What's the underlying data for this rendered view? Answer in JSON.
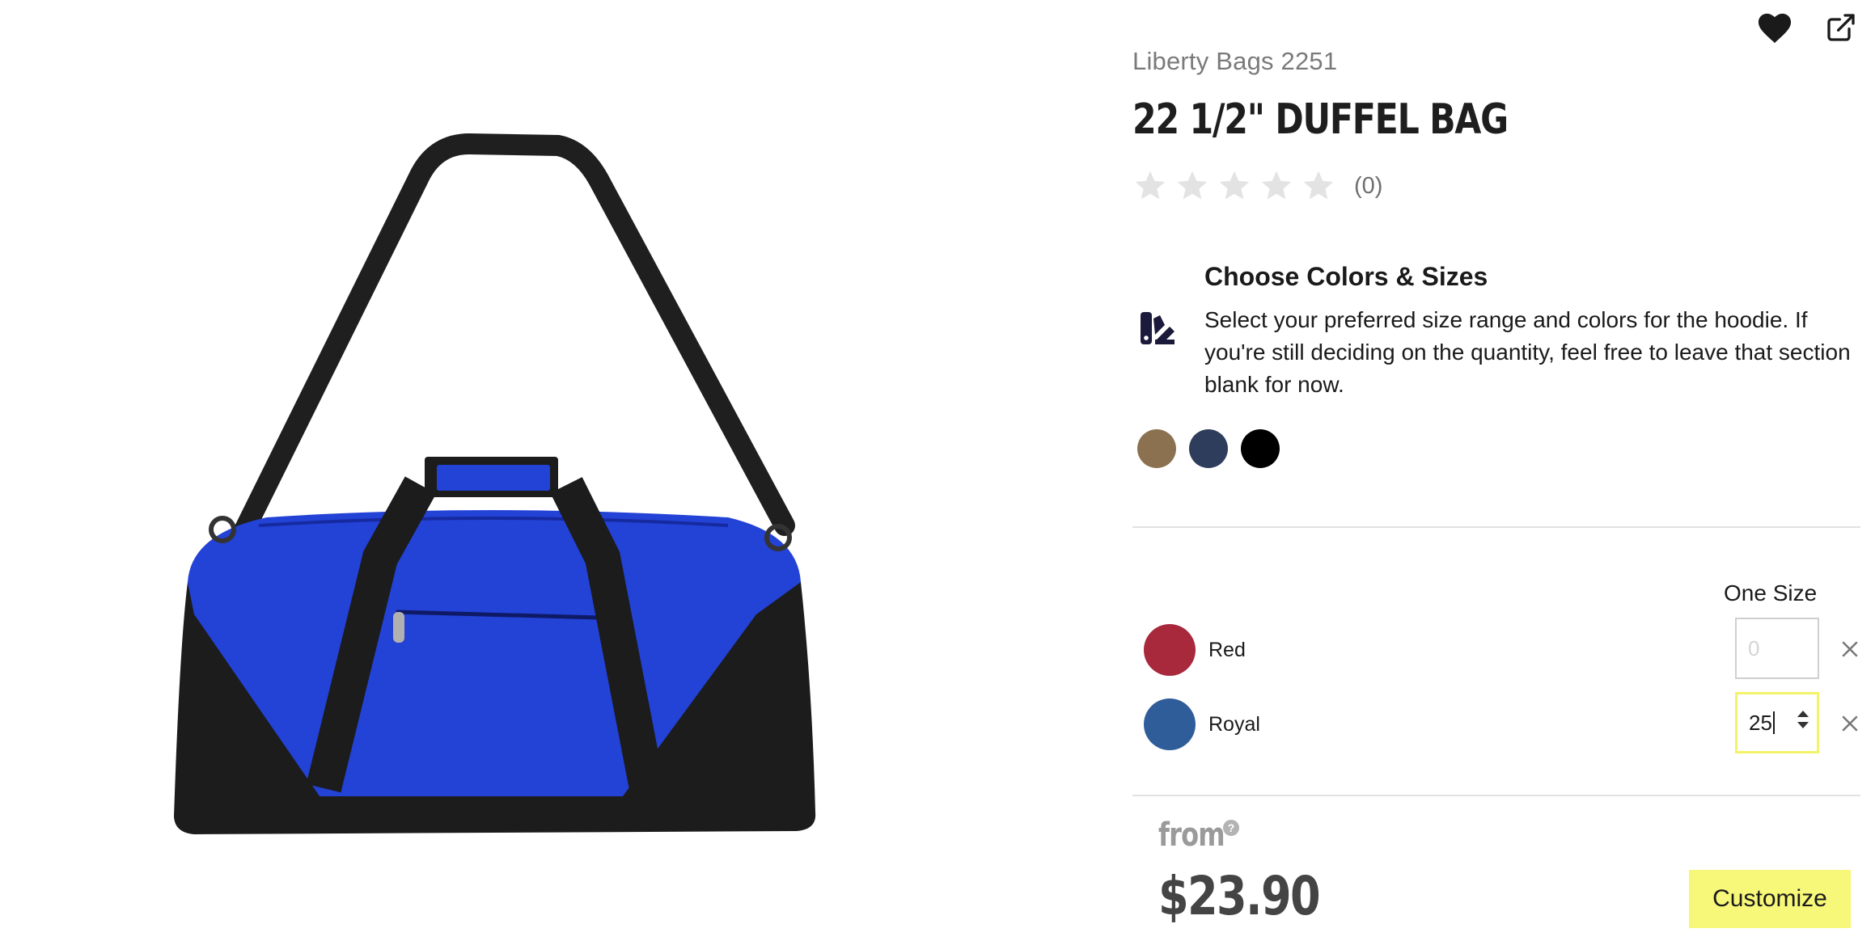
{
  "header": {
    "actions": [
      {
        "name": "favorite",
        "icon": "heart-icon"
      },
      {
        "name": "share",
        "icon": "external-link-icon"
      }
    ]
  },
  "product": {
    "image_alt": "Blue and black duffel bag",
    "brand_sku": "Liberty Bags 2251",
    "title": "22 1/2\" DUFFEL BAG",
    "rating": {
      "stars_filled": 0,
      "stars_total": 5,
      "count": "(0)"
    }
  },
  "choose": {
    "icon": "palette-icon",
    "heading": "Choose Colors & Sizes",
    "description": "Select your preferred size range and colors for the hoodie. If you're still deciding on the quantity, feel free to leave that section blank for now."
  },
  "swatches": [
    {
      "name": "khaki",
      "color": "#8b7150"
    },
    {
      "name": "navy",
      "color": "#2f3d5c"
    },
    {
      "name": "black",
      "color": "#000000"
    }
  ],
  "sizes": {
    "header": "One Size"
  },
  "selected_colors": [
    {
      "name": "Red",
      "color": "#a8283c",
      "qty_value": "",
      "qty_placeholder": "0",
      "active": false
    },
    {
      "name": "Royal",
      "color": "#2f5d9a",
      "qty_value": "25",
      "qty_placeholder": "0",
      "active": true
    }
  ],
  "pricing": {
    "from_label": "from",
    "help": "?",
    "price": "$23.90"
  },
  "cta": {
    "customize_label": "Customize",
    "color": "#f7f77a"
  }
}
